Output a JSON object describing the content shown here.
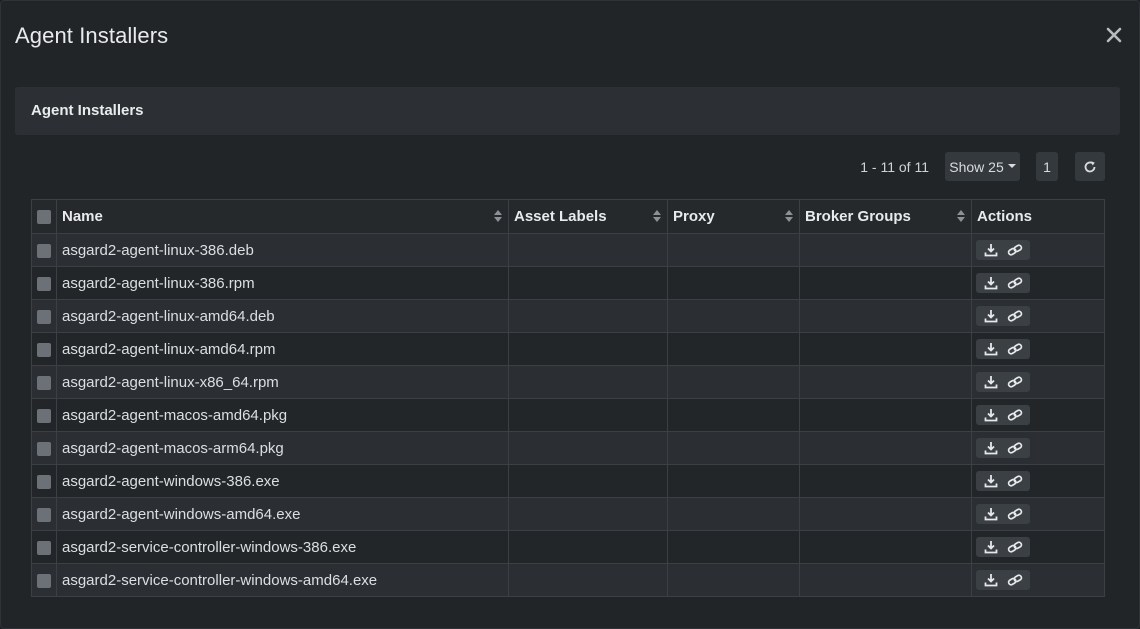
{
  "modal": {
    "title": "Agent Installers",
    "close_icon": "close-icon"
  },
  "card": {
    "title": "Agent Installers"
  },
  "toolbar": {
    "range_text": "1 - 11 of 11",
    "show_label": "Show 25",
    "current_page": "1",
    "refresh_icon": "refresh-icon"
  },
  "table": {
    "columns": [
      "Name",
      "Asset Labels",
      "Proxy",
      "Broker Groups",
      "Actions"
    ],
    "rows": [
      {
        "name": "asgard2-agent-linux-386.deb",
        "asset_labels": "",
        "proxy": "",
        "broker_groups": ""
      },
      {
        "name": "asgard2-agent-linux-386.rpm",
        "asset_labels": "",
        "proxy": "",
        "broker_groups": ""
      },
      {
        "name": "asgard2-agent-linux-amd64.deb",
        "asset_labels": "",
        "proxy": "",
        "broker_groups": ""
      },
      {
        "name": "asgard2-agent-linux-amd64.rpm",
        "asset_labels": "",
        "proxy": "",
        "broker_groups": ""
      },
      {
        "name": "asgard2-agent-linux-x86_64.rpm",
        "asset_labels": "",
        "proxy": "",
        "broker_groups": ""
      },
      {
        "name": "asgard2-agent-macos-amd64.pkg",
        "asset_labels": "",
        "proxy": "",
        "broker_groups": ""
      },
      {
        "name": "asgard2-agent-macos-arm64.pkg",
        "asset_labels": "",
        "proxy": "",
        "broker_groups": ""
      },
      {
        "name": "asgard2-agent-windows-386.exe",
        "asset_labels": "",
        "proxy": "",
        "broker_groups": ""
      },
      {
        "name": "asgard2-agent-windows-amd64.exe",
        "asset_labels": "",
        "proxy": "",
        "broker_groups": ""
      },
      {
        "name": "asgard2-service-controller-windows-386.exe",
        "asset_labels": "",
        "proxy": "",
        "broker_groups": ""
      },
      {
        "name": "asgard2-service-controller-windows-amd64.exe",
        "asset_labels": "",
        "proxy": "",
        "broker_groups": ""
      }
    ],
    "action_icons": [
      "download-icon",
      "link-icon"
    ]
  },
  "colors": {
    "background": "#222528",
    "card": "#2c3034",
    "row_odd": "#2b2f33",
    "row_even": "#232629",
    "border": "#3b4045"
  }
}
